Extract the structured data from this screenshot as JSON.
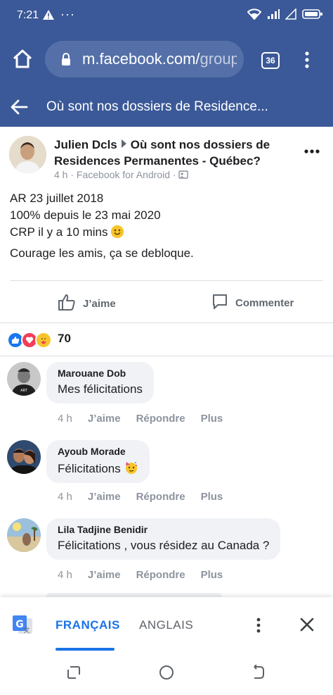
{
  "status": {
    "time": "7:21",
    "dots": "···"
  },
  "browser": {
    "url_domain": "m.facebook.com/",
    "url_rest": "group",
    "tab_count": "36"
  },
  "group_bar": {
    "title": "Où sont nos dossiers de Residence..."
  },
  "post": {
    "author": "Julien Dcls",
    "group": "Où sont nos dossiers de Residences Permanentes - Québec?",
    "time": "4 h",
    "source": "Facebook for Android",
    "line1": "AR 23 juillet 2018",
    "line2": "100% depuis le 23 mai 2020",
    "line3": "CRP il y a 10 mins",
    "line4": "Courage les amis, ça se debloque.",
    "like_label": "J’aime",
    "comment_label": "Commenter",
    "reaction_count": "70"
  },
  "comments": [
    {
      "name": "Marouane Dob",
      "text": "Mes félicitations",
      "time": "4 h",
      "like": "J’aime",
      "reply": "Répondre",
      "more": "Plus"
    },
    {
      "name": "Ayoub Morade",
      "text": "Félicitations",
      "time": "4 h",
      "like": "J’aime",
      "reply": "Répondre",
      "more": "Plus"
    },
    {
      "name": "Lila Tadjine Benidir",
      "text": "Félicitations , vous résidez au Canada ?",
      "time": "4 h",
      "like": "J’aime",
      "reply": "Répondre",
      "more": "Plus"
    }
  ],
  "translate_bar": {
    "lang_active": "FRANÇAIS",
    "lang_other": "ANGLAIS"
  },
  "colors": {
    "facebook_blue": "#3b5998",
    "translate_blue": "#1a73e8",
    "bubble_bg": "#f0f2f5"
  },
  "icons": [
    "warning-icon",
    "wifi-icon",
    "signal-icon",
    "battery-icon",
    "home-icon",
    "lock-icon",
    "tabs-icon",
    "menu-icon",
    "back-arrow-icon",
    "thumbs-up-icon",
    "comment-icon",
    "like-reaction-icon",
    "love-reaction-icon",
    "care-reaction-icon",
    "google-translate-icon",
    "close-icon",
    "recent-apps-icon",
    "home-nav-icon",
    "back-nav-icon"
  ]
}
